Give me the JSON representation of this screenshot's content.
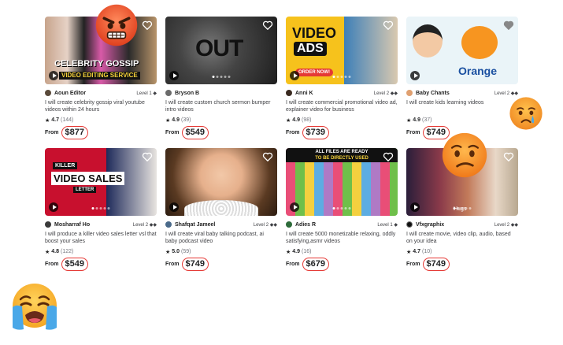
{
  "gigs": [
    {
      "thumb_lines": [
        "CELEBRITY GOSSIP",
        "VIDEO EDITING SERVICE"
      ],
      "seller": "Aoun Editor",
      "level": "Level 1 ◆",
      "title": "I will create celebrity gossip viral youtube videos within 24 hours",
      "rating": "4.7",
      "reviews": "(144)",
      "from": "From",
      "price": "$877"
    },
    {
      "thumb_lines": [
        "OUT"
      ],
      "seller": "Bryson B",
      "level": "",
      "title": "I will create custom church sermon bumper intro videos",
      "rating": "4.9",
      "reviews": "(39)",
      "from": "From",
      "price": "$549"
    },
    {
      "thumb_lines": [
        "VIDEO",
        "ADS",
        "ORDER NOW!"
      ],
      "seller": "Anni K",
      "level": "Level 2 ◆◆",
      "title": "I will create commercial promotional video ad, explainer video for business",
      "rating": "4.9",
      "reviews": "(98)",
      "from": "From",
      "price": "$739"
    },
    {
      "thumb_lines": [
        "Orange"
      ],
      "seller": "Baby Chants",
      "level": "Level 2 ◆◆",
      "title": "I will create kids learning videos",
      "rating": "4.9",
      "reviews": "(37)",
      "from": "From",
      "price": "$749"
    },
    {
      "thumb_lines": [
        "KILLER",
        "VIDEO SALES",
        "LETTER"
      ],
      "seller": "Mosharraf Ho",
      "level": "Level 2 ◆◆",
      "title": "I will produce a killer video sales letter vsl that boost your sales",
      "rating": "4.8",
      "reviews": "(122)",
      "from": "From",
      "price": "$549"
    },
    {
      "thumb_lines": [],
      "seller": "Shafqat Jameel",
      "level": "Level 2 ◆◆",
      "title": "I will create viral baby talking podcast, ai baby podcast video",
      "rating": "5.0",
      "reviews": "(59)",
      "from": "From",
      "price": "$749"
    },
    {
      "thumb_lines": [
        "ALL FILES ARE READY",
        "TO BE DIRECTLY USED"
      ],
      "seller": "Adies R",
      "level": "Level 1 ◆",
      "title": "I will create 5000 monetizable relaxing, oddly satisfying,asmr videos",
      "rating": "4.9",
      "reviews": "(16)",
      "from": "From",
      "price": "$679"
    },
    {
      "thumb_lines": [
        "Hugs"
      ],
      "seller": "Vfxgraphix",
      "level": "Level 2 ◆◆",
      "title": "I will create movie, video clip, audio, based on your idea",
      "rating": "4.7",
      "reviews": "(10)",
      "from": "From",
      "price": "$749"
    }
  ],
  "emojis": [
    {
      "name": "angry-face-emoji"
    },
    {
      "name": "crying-face-emoji"
    },
    {
      "name": "confused-face-emoji"
    },
    {
      "name": "loudly-crying-face-emoji"
    }
  ]
}
